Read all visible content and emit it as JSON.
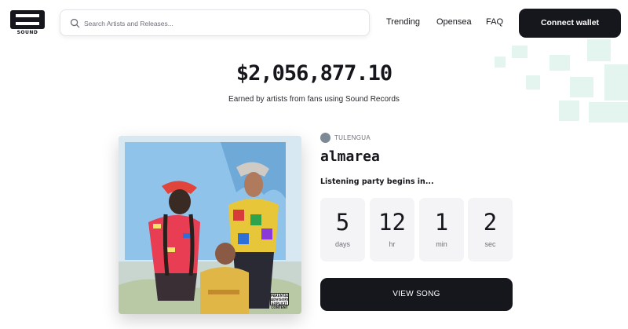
{
  "brand": {
    "logo_word": "SOUND"
  },
  "search": {
    "placeholder": "Search Artists and Releases..."
  },
  "nav": {
    "items": [
      {
        "label": "Trending"
      },
      {
        "label": "Opensea"
      },
      {
        "label": "FAQ"
      }
    ],
    "connect_label": "Connect wallet"
  },
  "hero": {
    "total": "$2,056,877.10",
    "subtitle": "Earned by artists from fans using Sound Records"
  },
  "release": {
    "artist": "TULENGUA",
    "title": "almarea",
    "party_label": "Listening party begins in...",
    "countdown": [
      {
        "value": "5",
        "unit": "days"
      },
      {
        "value": "12",
        "unit": "hr"
      },
      {
        "value": "1",
        "unit": "min"
      },
      {
        "value": "2",
        "unit": "sec"
      }
    ],
    "cta_label": "VIEW SONG",
    "advisory": "PARENTAL ADVISORY EXPLICIT CONTENT"
  },
  "colors": {
    "primary": "#16171c",
    "muted_text": "#6f707a",
    "tile_bg": "#f4f4f6",
    "decor_teal": "#e3f5ee"
  }
}
